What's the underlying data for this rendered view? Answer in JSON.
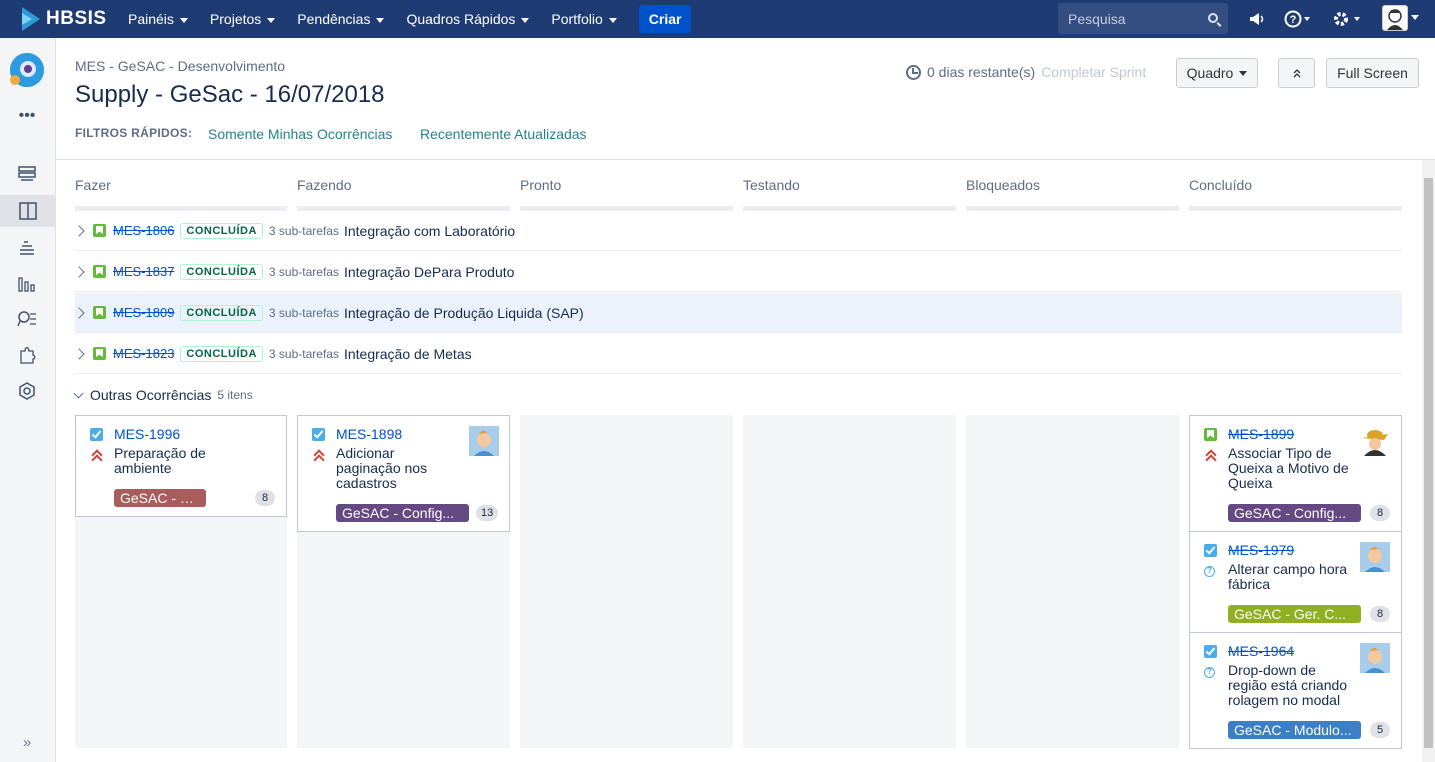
{
  "topnav": {
    "logo_text": "HBSIS",
    "items": [
      {
        "label": "Painéis"
      },
      {
        "label": "Projetos"
      },
      {
        "label": "Pendências"
      },
      {
        "label": "Quadros Rápidos"
      },
      {
        "label": "Portfolio"
      }
    ],
    "create_label": "Criar",
    "search_placeholder": "Pesquisa",
    "icons": [
      "megaphone-icon",
      "help-icon",
      "settings-icon",
      "user-avatar"
    ]
  },
  "sidebar": {
    "icons": [
      "project-avatar",
      "more-icon",
      "backlog-icon",
      "board-icon",
      "releases-icon",
      "reports-icon",
      "issues-icon",
      "addons-icon",
      "settings-icon",
      "expand-icon"
    ]
  },
  "header": {
    "breadcrumb": "MES - GeSAC - Desenvolvimento",
    "title": "Supply - GeSac - 16/07/2018",
    "sprint_remaining": "0 dias restante(s)",
    "complete_sprint": "Completar Sprint",
    "board_button": "Quadro",
    "fullscreen_button": "Full Screen",
    "quick_filters_label": "FILTROS RÁPIDOS:",
    "quick_filters": [
      "Somente Minhas Ocorrências",
      "Recentemente Atualizadas"
    ]
  },
  "columns": [
    "Fazer",
    "Fazendo",
    "Pronto",
    "Testando",
    "Bloqueados",
    "Concluído"
  ],
  "swimlanes": [
    {
      "key": "MES-1806",
      "status": "CONCLUÍDA",
      "subtasks": "3 sub-tarefas",
      "summary": "Integração com Laboratório"
    },
    {
      "key": "MES-1837",
      "status": "CONCLUÍDA",
      "subtasks": "3 sub-tarefas",
      "summary": "Integração DePara Produto"
    },
    {
      "key": "MES-1809",
      "status": "CONCLUÍDA",
      "subtasks": "3 sub-tarefas",
      "summary": "Integração de Produção Liquida (SAP)"
    },
    {
      "key": "MES-1823",
      "status": "CONCLUÍDA",
      "subtasks": "3 sub-tarefas",
      "summary": "Integração de Metas"
    }
  ],
  "others": {
    "label": "Outras Ocorrências",
    "count": "5 itens"
  },
  "cards": [
    {
      "key": "MES-1996",
      "summary_lines": [
        "Preparação de",
        "ambiente"
      ],
      "epic": "GeSAC - QA",
      "epic_color": "#a85c5c",
      "estimate": "8"
    },
    {
      "key": "MES-1898",
      "summary_lines": [
        "Adicionar",
        "paginação nos",
        "cadastros"
      ],
      "epic": "GeSAC - Config...",
      "epic_color": "#654982",
      "estimate": "13"
    },
    {
      "key": "MES-1899",
      "summary_lines": [
        "Associar Tipo de",
        "Queixa a Motivo de",
        "Queixa"
      ],
      "epic": "GeSAC - Config...",
      "epic_color": "#654982",
      "estimate": "8"
    },
    {
      "key": "MES-1979",
      "summary_lines": [
        "Alterar campo hora",
        "fábrica"
      ],
      "epic": "GeSAC - Ger. C...",
      "epic_color": "#8eb021",
      "estimate": "8"
    },
    {
      "key": "MES-1964",
      "summary_lines": [
        "Drop-down de",
        "região está criando",
        "rolagem no modal"
      ],
      "epic": "GeSAC - Modulo...",
      "epic_color": "#3b7fc4",
      "estimate": "5"
    }
  ]
}
